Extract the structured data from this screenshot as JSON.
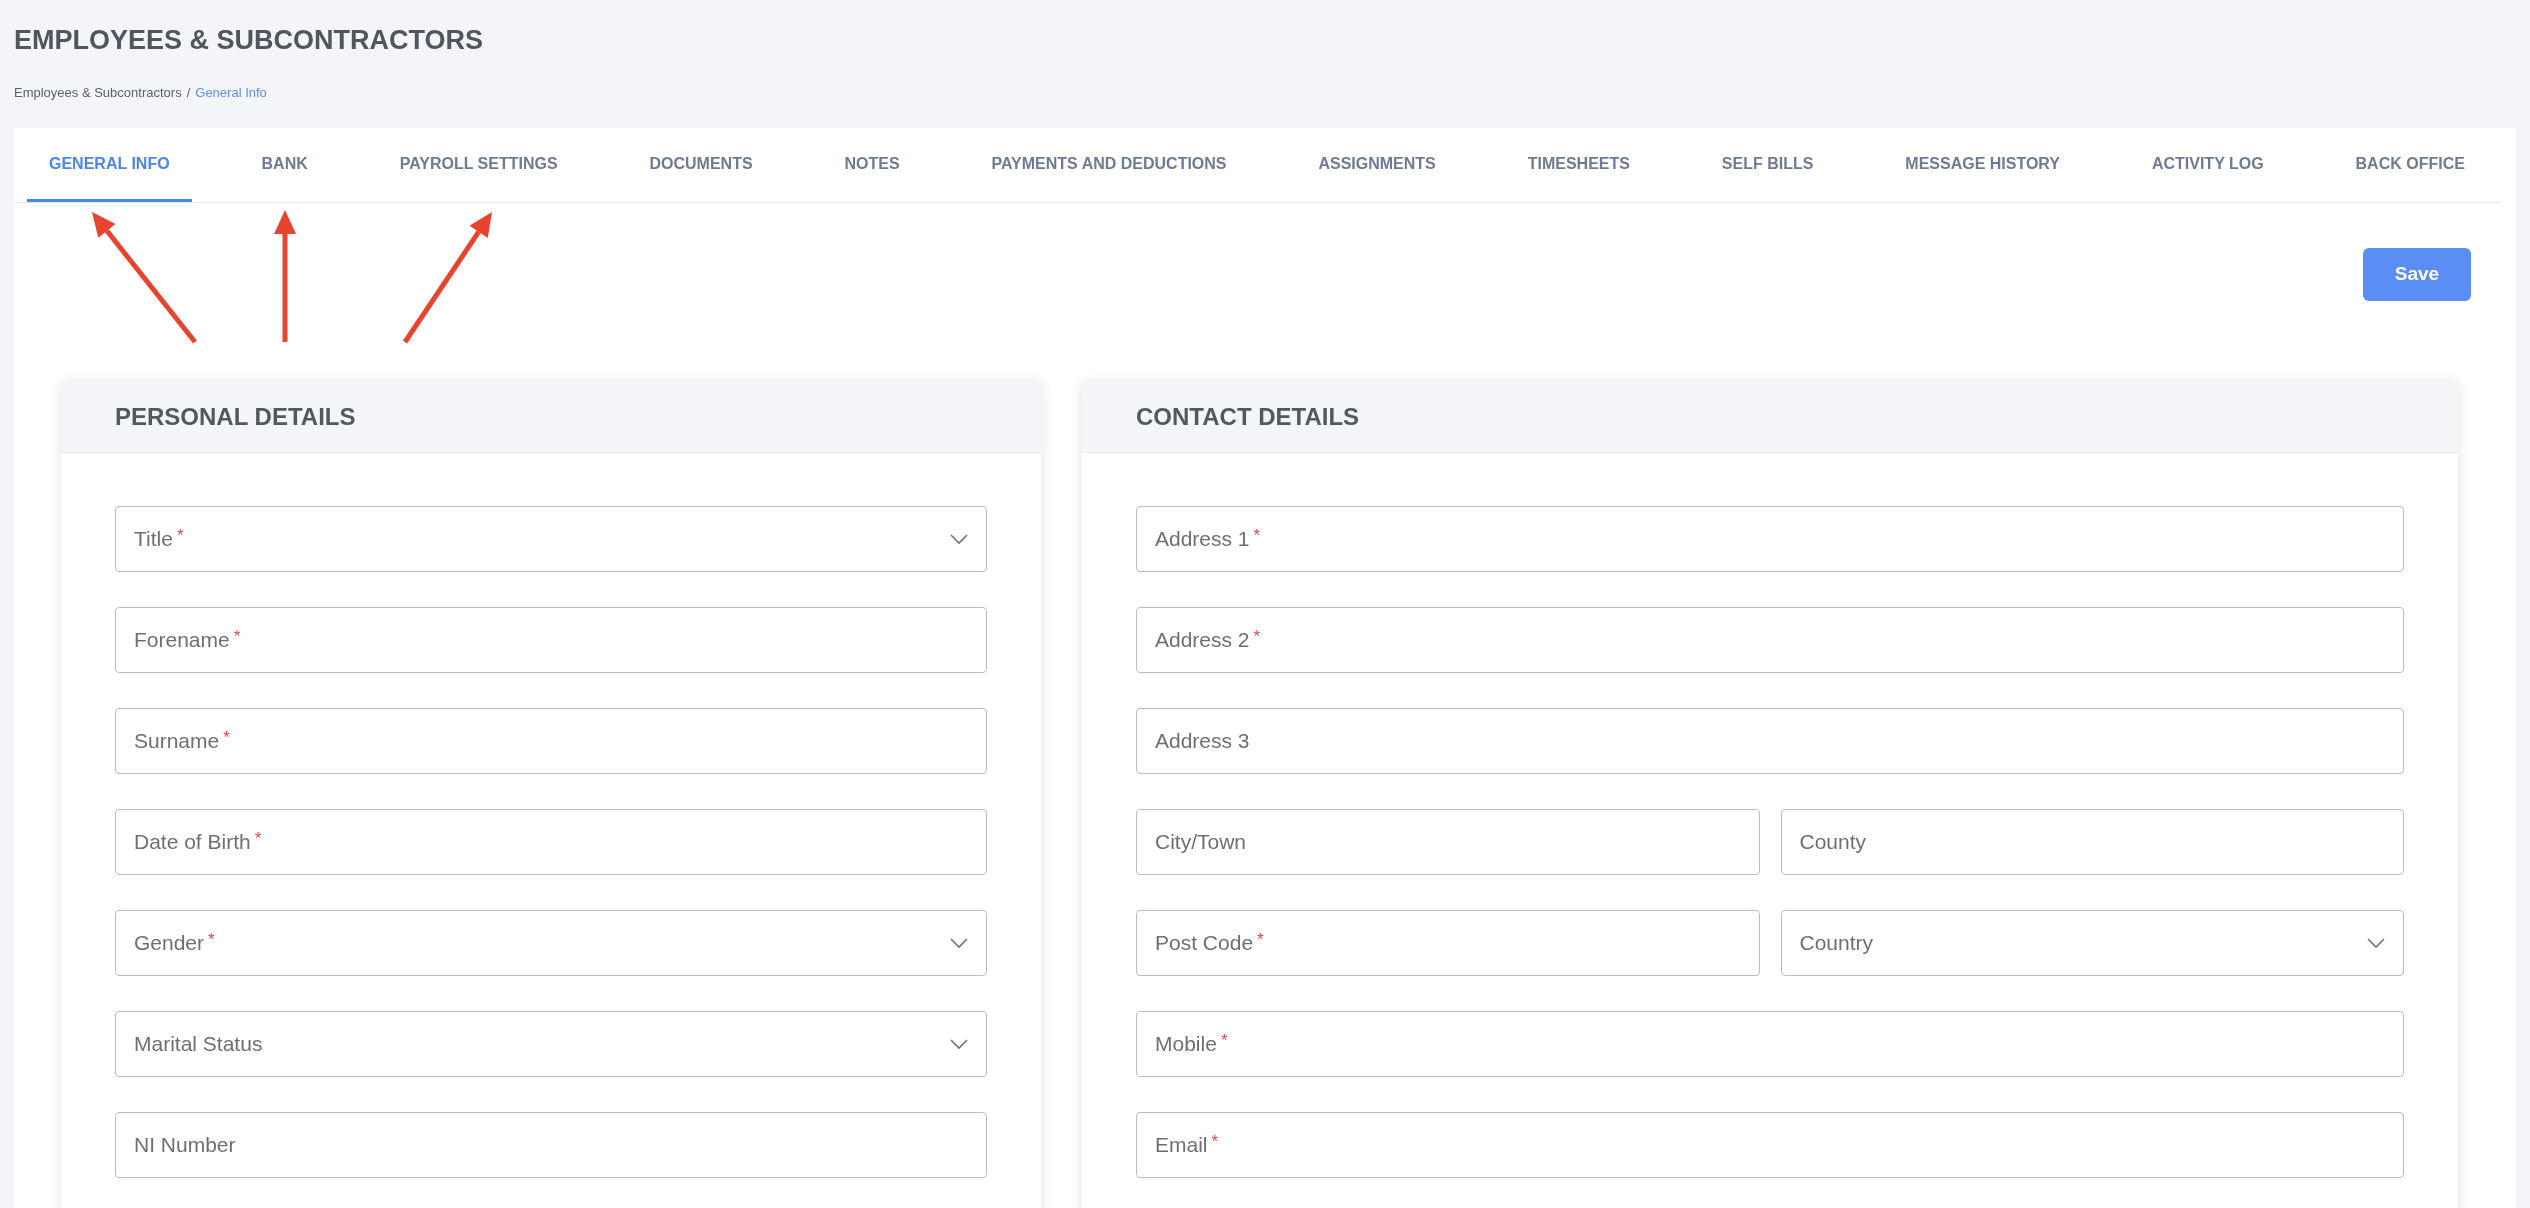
{
  "page": {
    "title": "EMPLOYEES & SUBCONTRACTORS"
  },
  "breadcrumb": [
    {
      "label": "Employees & Subcontractors",
      "current": false
    },
    {
      "label": "General Info",
      "current": true
    }
  ],
  "breadcrumb_separator": "/",
  "tabs": [
    {
      "label": "GENERAL INFO",
      "selected": true
    },
    {
      "label": "BANK",
      "selected": false
    },
    {
      "label": "PAYROLL SETTINGS",
      "selected": false
    },
    {
      "label": "DOCUMENTS",
      "selected": false
    },
    {
      "label": "NOTES",
      "selected": false
    },
    {
      "label": "PAYMENTS AND DEDUCTIONS",
      "selected": false
    },
    {
      "label": "ASSIGNMENTS",
      "selected": false
    },
    {
      "label": "TIMESHEETS",
      "selected": false
    },
    {
      "label": "SELF BILLS",
      "selected": false
    },
    {
      "label": "MESSAGE HISTORY",
      "selected": false
    },
    {
      "label": "ACTIVITY LOG",
      "selected": false
    },
    {
      "label": "BACK OFFICE",
      "selected": false
    }
  ],
  "save_button": "Save",
  "required_mark": "*",
  "cards": [
    {
      "title": "PERSONAL DETAILS",
      "rows": [
        [
          {
            "kind": "select",
            "placeholder": "Title",
            "required": true
          }
        ],
        [
          {
            "kind": "text",
            "placeholder": "Forename",
            "required": true
          }
        ],
        [
          {
            "kind": "text",
            "placeholder": "Surname",
            "required": true
          }
        ],
        [
          {
            "kind": "text",
            "placeholder": "Date of Birth",
            "required": true
          }
        ],
        [
          {
            "kind": "select",
            "placeholder": "Gender",
            "required": true
          }
        ],
        [
          {
            "kind": "select",
            "placeholder": "Marital Status",
            "required": false
          }
        ],
        [
          {
            "kind": "text",
            "placeholder": "NI Number",
            "required": false
          }
        ]
      ]
    },
    {
      "title": "CONTACT DETAILS",
      "rows": [
        [
          {
            "kind": "text",
            "placeholder": "Address 1",
            "required": true
          }
        ],
        [
          {
            "kind": "text",
            "placeholder": "Address 2",
            "required": true
          }
        ],
        [
          {
            "kind": "text",
            "placeholder": "Address 3",
            "required": false
          }
        ],
        [
          {
            "kind": "text",
            "placeholder": "City/Town",
            "required": false
          },
          {
            "kind": "text",
            "placeholder": "County",
            "required": false
          }
        ],
        [
          {
            "kind": "text",
            "placeholder": "Post Code",
            "required": true
          },
          {
            "kind": "select",
            "placeholder": "Country",
            "required": false
          }
        ],
        [
          {
            "kind": "text",
            "placeholder": "Mobile",
            "required": true
          }
        ],
        [
          {
            "kind": "text",
            "placeholder": "Email",
            "required": true
          }
        ]
      ]
    }
  ]
}
